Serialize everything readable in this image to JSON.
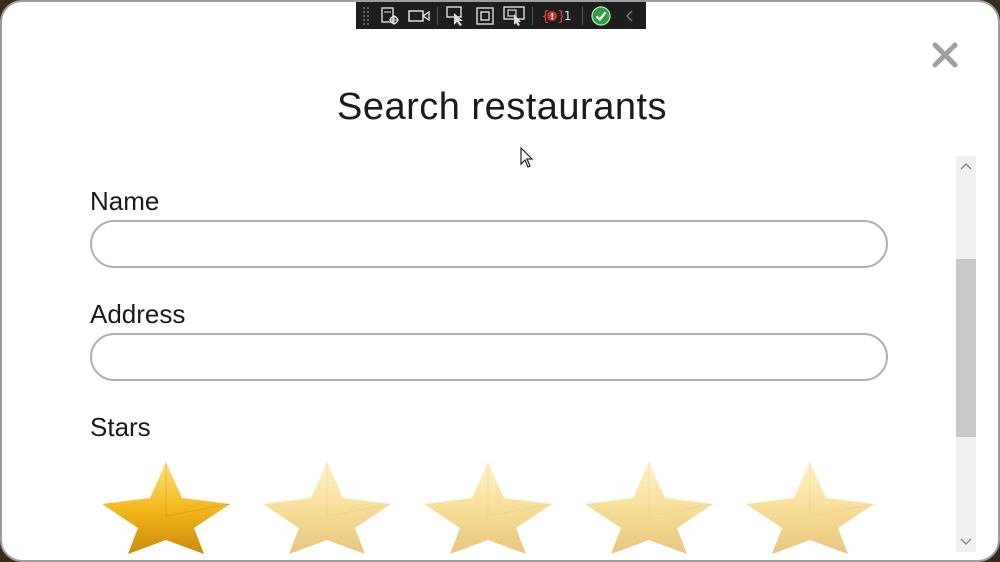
{
  "dialog": {
    "title": "Search restaurants"
  },
  "form": {
    "name_label": "Name",
    "name_value": "",
    "address_label": "Address",
    "address_value": "",
    "stars_label": "Stars",
    "stars_selected": 1,
    "stars_total": 5
  },
  "devtools": {
    "binding_error_count": "1",
    "icons": [
      "live-visual-tree-icon",
      "record-icon",
      "select-element-icon",
      "display-layout-adorners-icon",
      "track-focus-icon",
      "binding-errors-icon",
      "hot-reload-ok-icon",
      "collapse-chevron-icon"
    ]
  },
  "colors": {
    "star_filled": "#f2b418",
    "star_empty": "#f7dc95",
    "field_border": "#b0b0b0",
    "background": "#ffffff"
  }
}
